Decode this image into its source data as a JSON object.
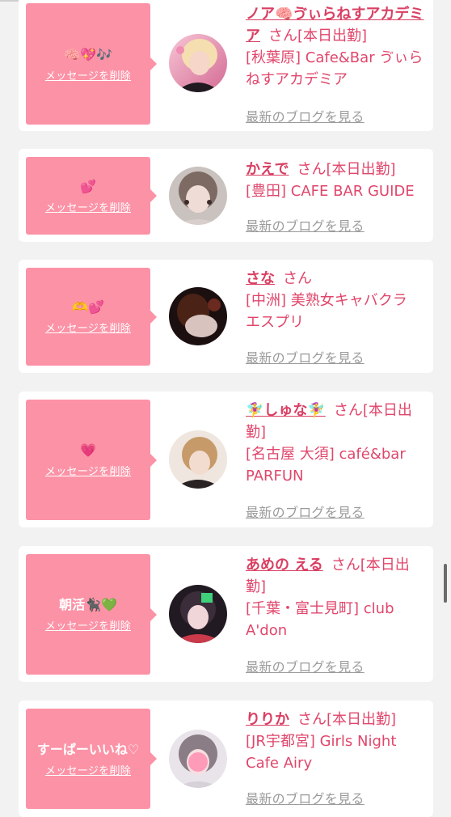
{
  "ui": {
    "delete_label": "メッセージを削除",
    "blog_label": "最新のブログを見る"
  },
  "cards": [
    {
      "message": "🧠💖🎶",
      "name": "ノア🧠ゔぃらねすアカデミア",
      "suffix": "さん[本日出勤]",
      "location": "[秋葉原] Cafe&Bar ゔぃらねすアカデミア"
    },
    {
      "message": "💕",
      "name": "かえで",
      "suffix": "さん[本日出勤]",
      "location": "[豊田] CAFE BAR GUIDE"
    },
    {
      "message": "🫶💕",
      "name": "さな",
      "suffix": "さん",
      "location": "[中洲] 美熟女キャバクラ エスプリ"
    },
    {
      "message": "💗",
      "name": "🧚‍♀️しゅな🧚‍♀️",
      "suffix": "さん[本日出勤]",
      "location": "[名古屋 大須] café&bar PARFUN"
    },
    {
      "message": "朝活🐈‍⬛💚",
      "name": "あめの える",
      "suffix": "さん[本日出勤]",
      "location": "[千葉・富士見町] club A'don"
    },
    {
      "message": "すーぱーいいね♡",
      "name": "りりか",
      "suffix": "さん[本日出勤]",
      "location": "[JR宇都宮] Girls Night Cafe Airy"
    }
  ],
  "colors": {
    "bubble": "#fc92a6",
    "accent_text": "#e0466b",
    "link_gray": "#9b9b9b",
    "background": "#f2f2f2",
    "card": "#ffffff"
  }
}
